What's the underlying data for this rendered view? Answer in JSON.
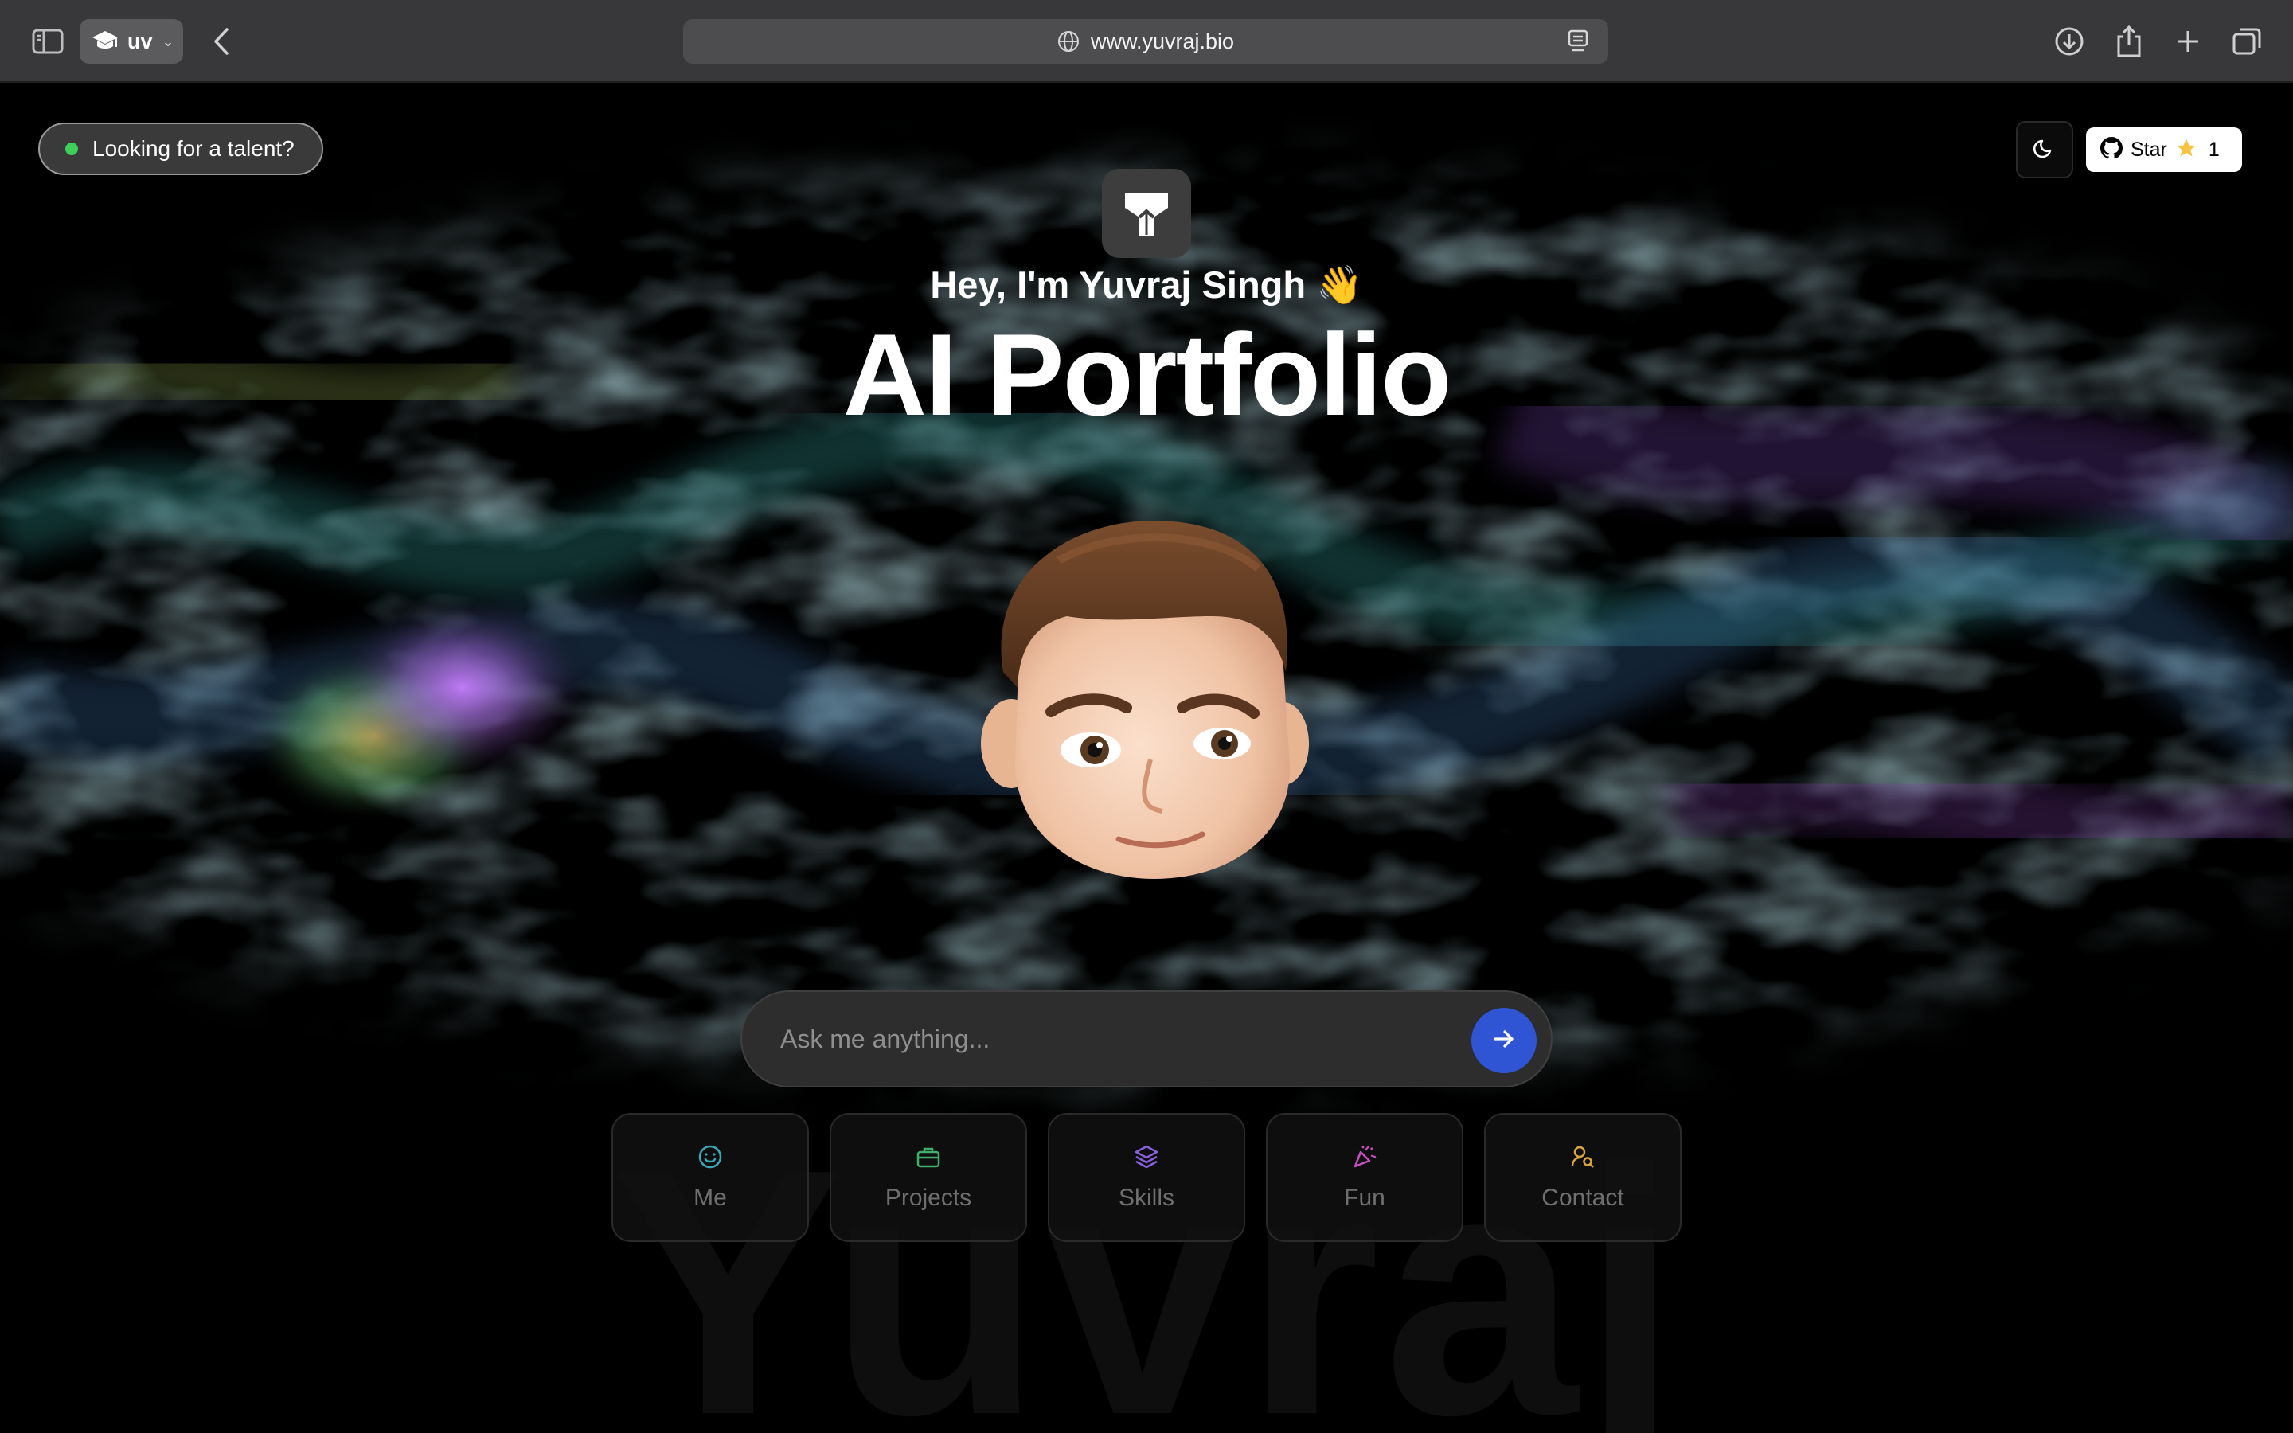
{
  "browser": {
    "profile_name": "uv",
    "url": "www.yuvraj.bio",
    "icons": [
      "sidebar-icon",
      "graduation-cap-icon",
      "chevron-down-icon",
      "back-icon",
      "globe-icon",
      "reader-icon",
      "download-icon",
      "share-icon",
      "plus-icon",
      "tabs-icon"
    ]
  },
  "header": {
    "talent_label": "Looking for a talent?",
    "star_label": "Star",
    "star_count": "1",
    "theme_icon": "moon-icon",
    "github_icon": "github-icon"
  },
  "hero": {
    "greeting": "Hey, I'm Yuvraj Singh 👋",
    "title": "AI Portfolio",
    "watermark": "Yuvraj"
  },
  "chat": {
    "placeholder": "Ask me anything..."
  },
  "quick_actions": [
    {
      "label": "Me",
      "icon": "smile-icon",
      "color": "#3ba6b7"
    },
    {
      "label": "Projects",
      "icon": "briefcase-icon",
      "color": "#3fae6a"
    },
    {
      "label": "Skills",
      "icon": "layers-icon",
      "color": "#8a62e0"
    },
    {
      "label": "Fun",
      "icon": "party-popper-icon",
      "color": "#c94fc0"
    },
    {
      "label": "Contact",
      "icon": "user-search-icon",
      "color": "#d9a43a"
    }
  ],
  "colors": {
    "accent": "#2f55d4",
    "status_dot": "#3ecf5a"
  }
}
